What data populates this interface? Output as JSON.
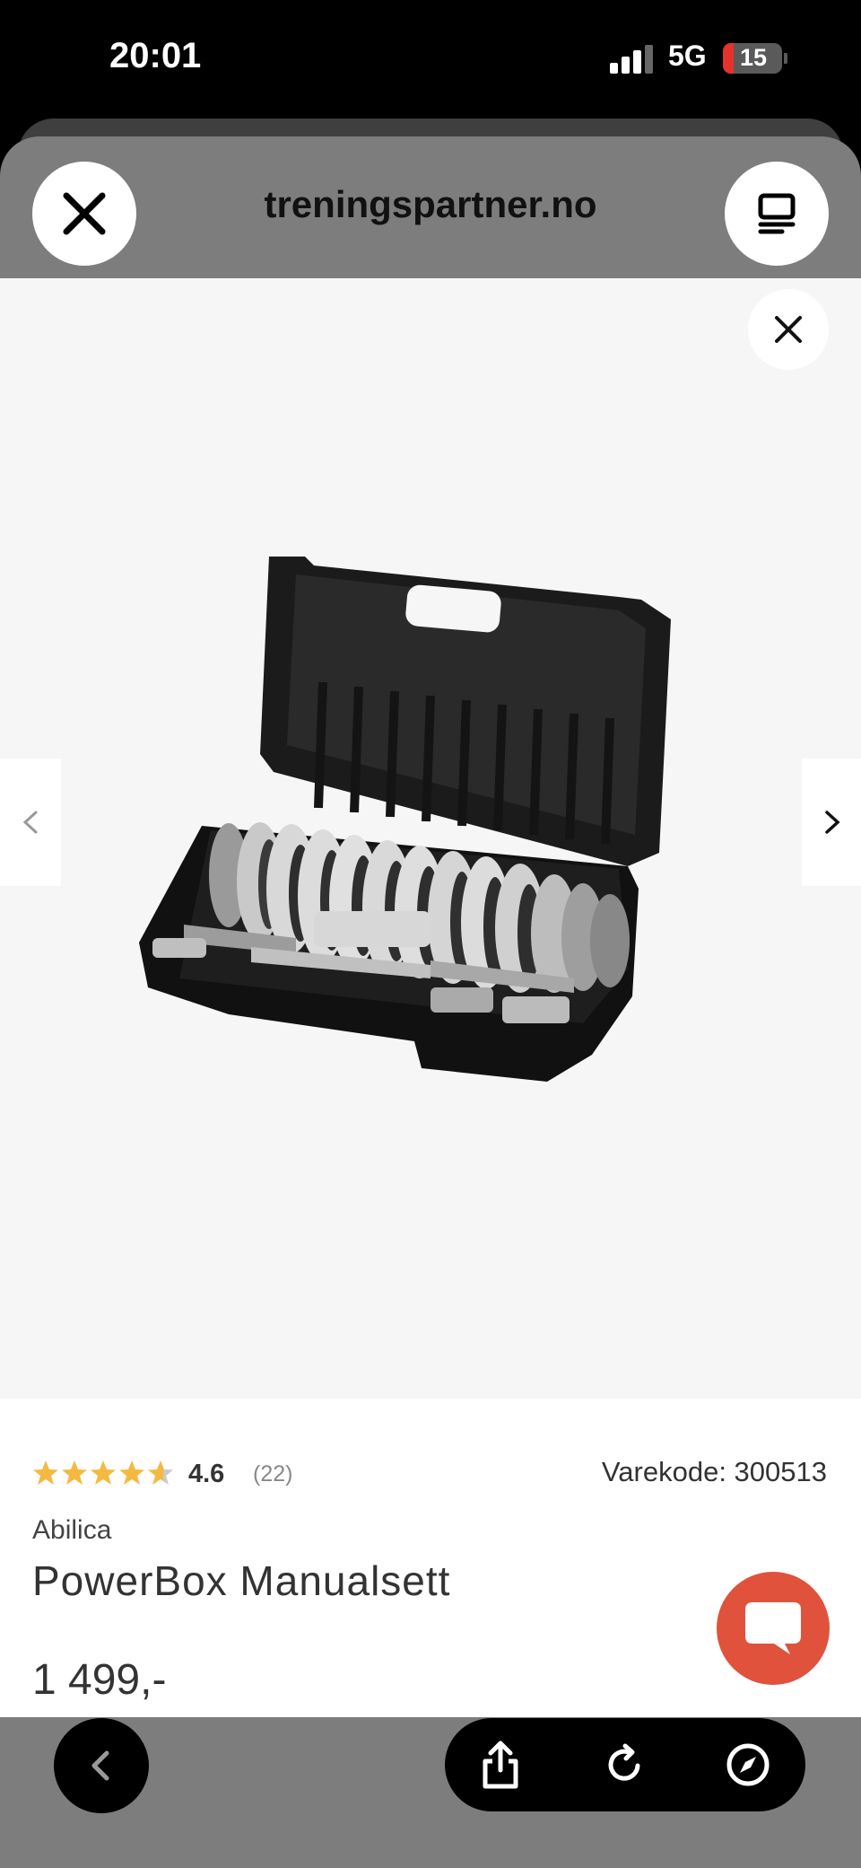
{
  "status_bar": {
    "time": "20:01",
    "network": "5G",
    "battery": "15",
    "icons": [
      "signal-icon",
      "battery-charging-icon"
    ]
  },
  "browser": {
    "domain": "treningspartner.no",
    "icons": [
      "close-icon",
      "tabs-icon"
    ]
  },
  "gallery": {
    "icons": [
      "close-icon",
      "chevron-left-icon",
      "chevron-right-icon"
    ]
  },
  "product": {
    "rating": "4.6",
    "review_count": "(22)",
    "rating_value": 4.6,
    "sku": "Varekode: 300513",
    "brand": "Abilica",
    "name": "PowerBox Manualsett",
    "price": "1 499,-"
  },
  "colors": {
    "chat_accent": "#e0523c",
    "star": "#f5b942",
    "battery_low": "#e5322d"
  },
  "toolbar": {
    "icons": [
      "back-icon",
      "share-icon",
      "reload-icon",
      "compass-icon"
    ]
  }
}
